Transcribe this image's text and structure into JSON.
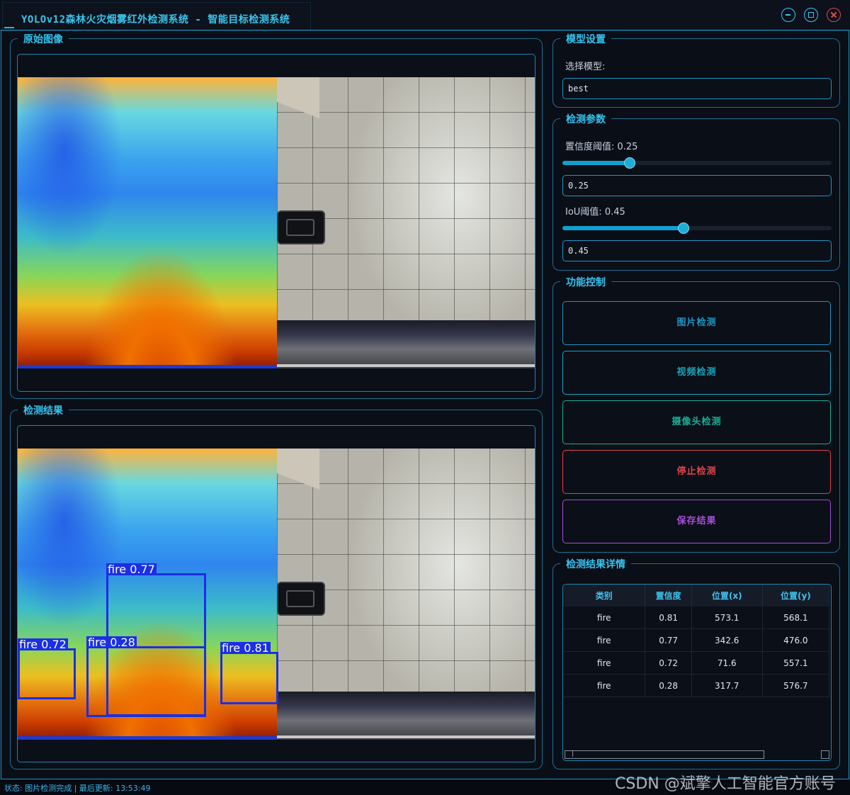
{
  "window": {
    "title": "YOLOv12森林火灾烟雾红外检测系统 - 智能目标检测系统"
  },
  "panels": {
    "original_title": "原始图像",
    "result_title": "检测结果"
  },
  "detections": [
    {
      "label": "fire 0.77"
    },
    {
      "label": "fire 0.72"
    },
    {
      "label": "fire 0.28"
    },
    {
      "label": "fire 0.81"
    }
  ],
  "model_settings": {
    "title": "模型设置",
    "select_label": "选择模型:",
    "selected_model": "best"
  },
  "detection_params": {
    "title": "检测参数",
    "confidence_label": "置信度阈值: 0.25",
    "confidence_value": "0.25",
    "confidence_fraction": 0.25,
    "iou_label": "IoU阈值: 0.45",
    "iou_value": "0.45",
    "iou_fraction": 0.45
  },
  "controls": {
    "title": "功能控制",
    "image_detect": "图片检测",
    "video_detect": "视频检测",
    "camera_detect": "摄像头检测",
    "stop_detect": "停止检测",
    "save_results": "保存结果",
    "colors": {
      "image_detect": "#1d95c4",
      "video_detect": "#1aa5bd",
      "camera_detect": "#1bae96",
      "stop_detect": "#e0444a",
      "save_results": "#a64fd6"
    }
  },
  "results_table": {
    "title": "检测结果详情",
    "headers": [
      "类别",
      "置信度",
      "位置(x)",
      "位置(y)"
    ],
    "rows": [
      [
        "fire",
        "0.81",
        "573.1",
        "568.1"
      ],
      [
        "fire",
        "0.77",
        "342.6",
        "476.0"
      ],
      [
        "fire",
        "0.72",
        "71.6",
        "557.1"
      ],
      [
        "fire",
        "0.28",
        "317.7",
        "576.7"
      ]
    ]
  },
  "status": {
    "text": "状态: 图片检测完成 | 最后更新: 13:53:49"
  },
  "watermark": "CSDN @斌擎人工智能官方账号"
}
